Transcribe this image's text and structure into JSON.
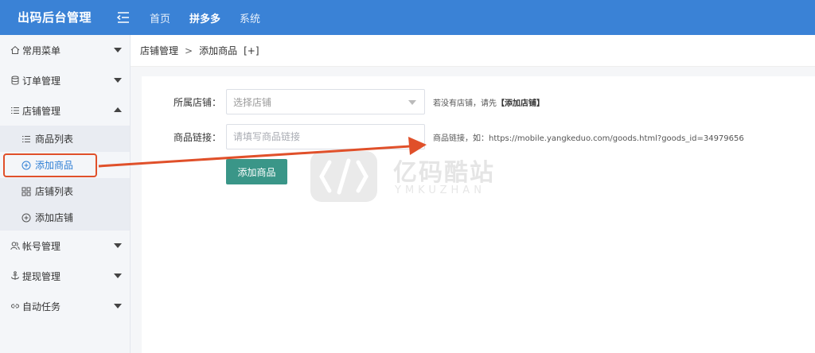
{
  "app": {
    "title": "出码后台管理"
  },
  "topnav": {
    "items": [
      "首页",
      "拼多多",
      "系统"
    ],
    "active_index": 1
  },
  "sidebar": {
    "menu": [
      {
        "label": "常用菜单",
        "icon": "home-icon",
        "expanded": false
      },
      {
        "label": "订单管理",
        "icon": "database-icon",
        "expanded": false
      },
      {
        "label": "店铺管理",
        "icon": "list-icon",
        "expanded": true
      },
      {
        "label": "帐号管理",
        "icon": "users-icon",
        "expanded": false
      },
      {
        "label": "提现管理",
        "icon": "anchor-icon",
        "expanded": false
      },
      {
        "label": "自动任务",
        "icon": "link-icon",
        "expanded": false
      }
    ],
    "shop_submenu": [
      {
        "label": "商品列表",
        "icon": "list-icon"
      },
      {
        "label": "添加商品",
        "icon": "plus-circle-icon",
        "active": true
      },
      {
        "label": "店铺列表",
        "icon": "grid-icon"
      },
      {
        "label": "添加店铺",
        "icon": "plus-circle-icon"
      }
    ]
  },
  "breadcrumb": {
    "parent": "店铺管理",
    "separator": ">",
    "current": "添加商品",
    "extra": "[+]"
  },
  "form": {
    "shop": {
      "label": "所属店铺：",
      "placeholder": "选择店铺",
      "hint_prefix": "若没有店铺，请先",
      "hint_link": "【添加店铺】"
    },
    "link": {
      "label": "商品链接：",
      "placeholder": "请填写商品链接",
      "hint": "商品链接，如：https://mobile.yangkeduo.com/goods.html?goods_id=34979656"
    },
    "submit_label": "添加商品"
  },
  "watermark": {
    "title": "亿码酷站",
    "subtitle": "YMKUZHAN"
  },
  "colors": {
    "topbar": "#3a82d6",
    "accent": "#2f7fd5",
    "button": "#3a9688",
    "annotation": "#e0502a"
  }
}
